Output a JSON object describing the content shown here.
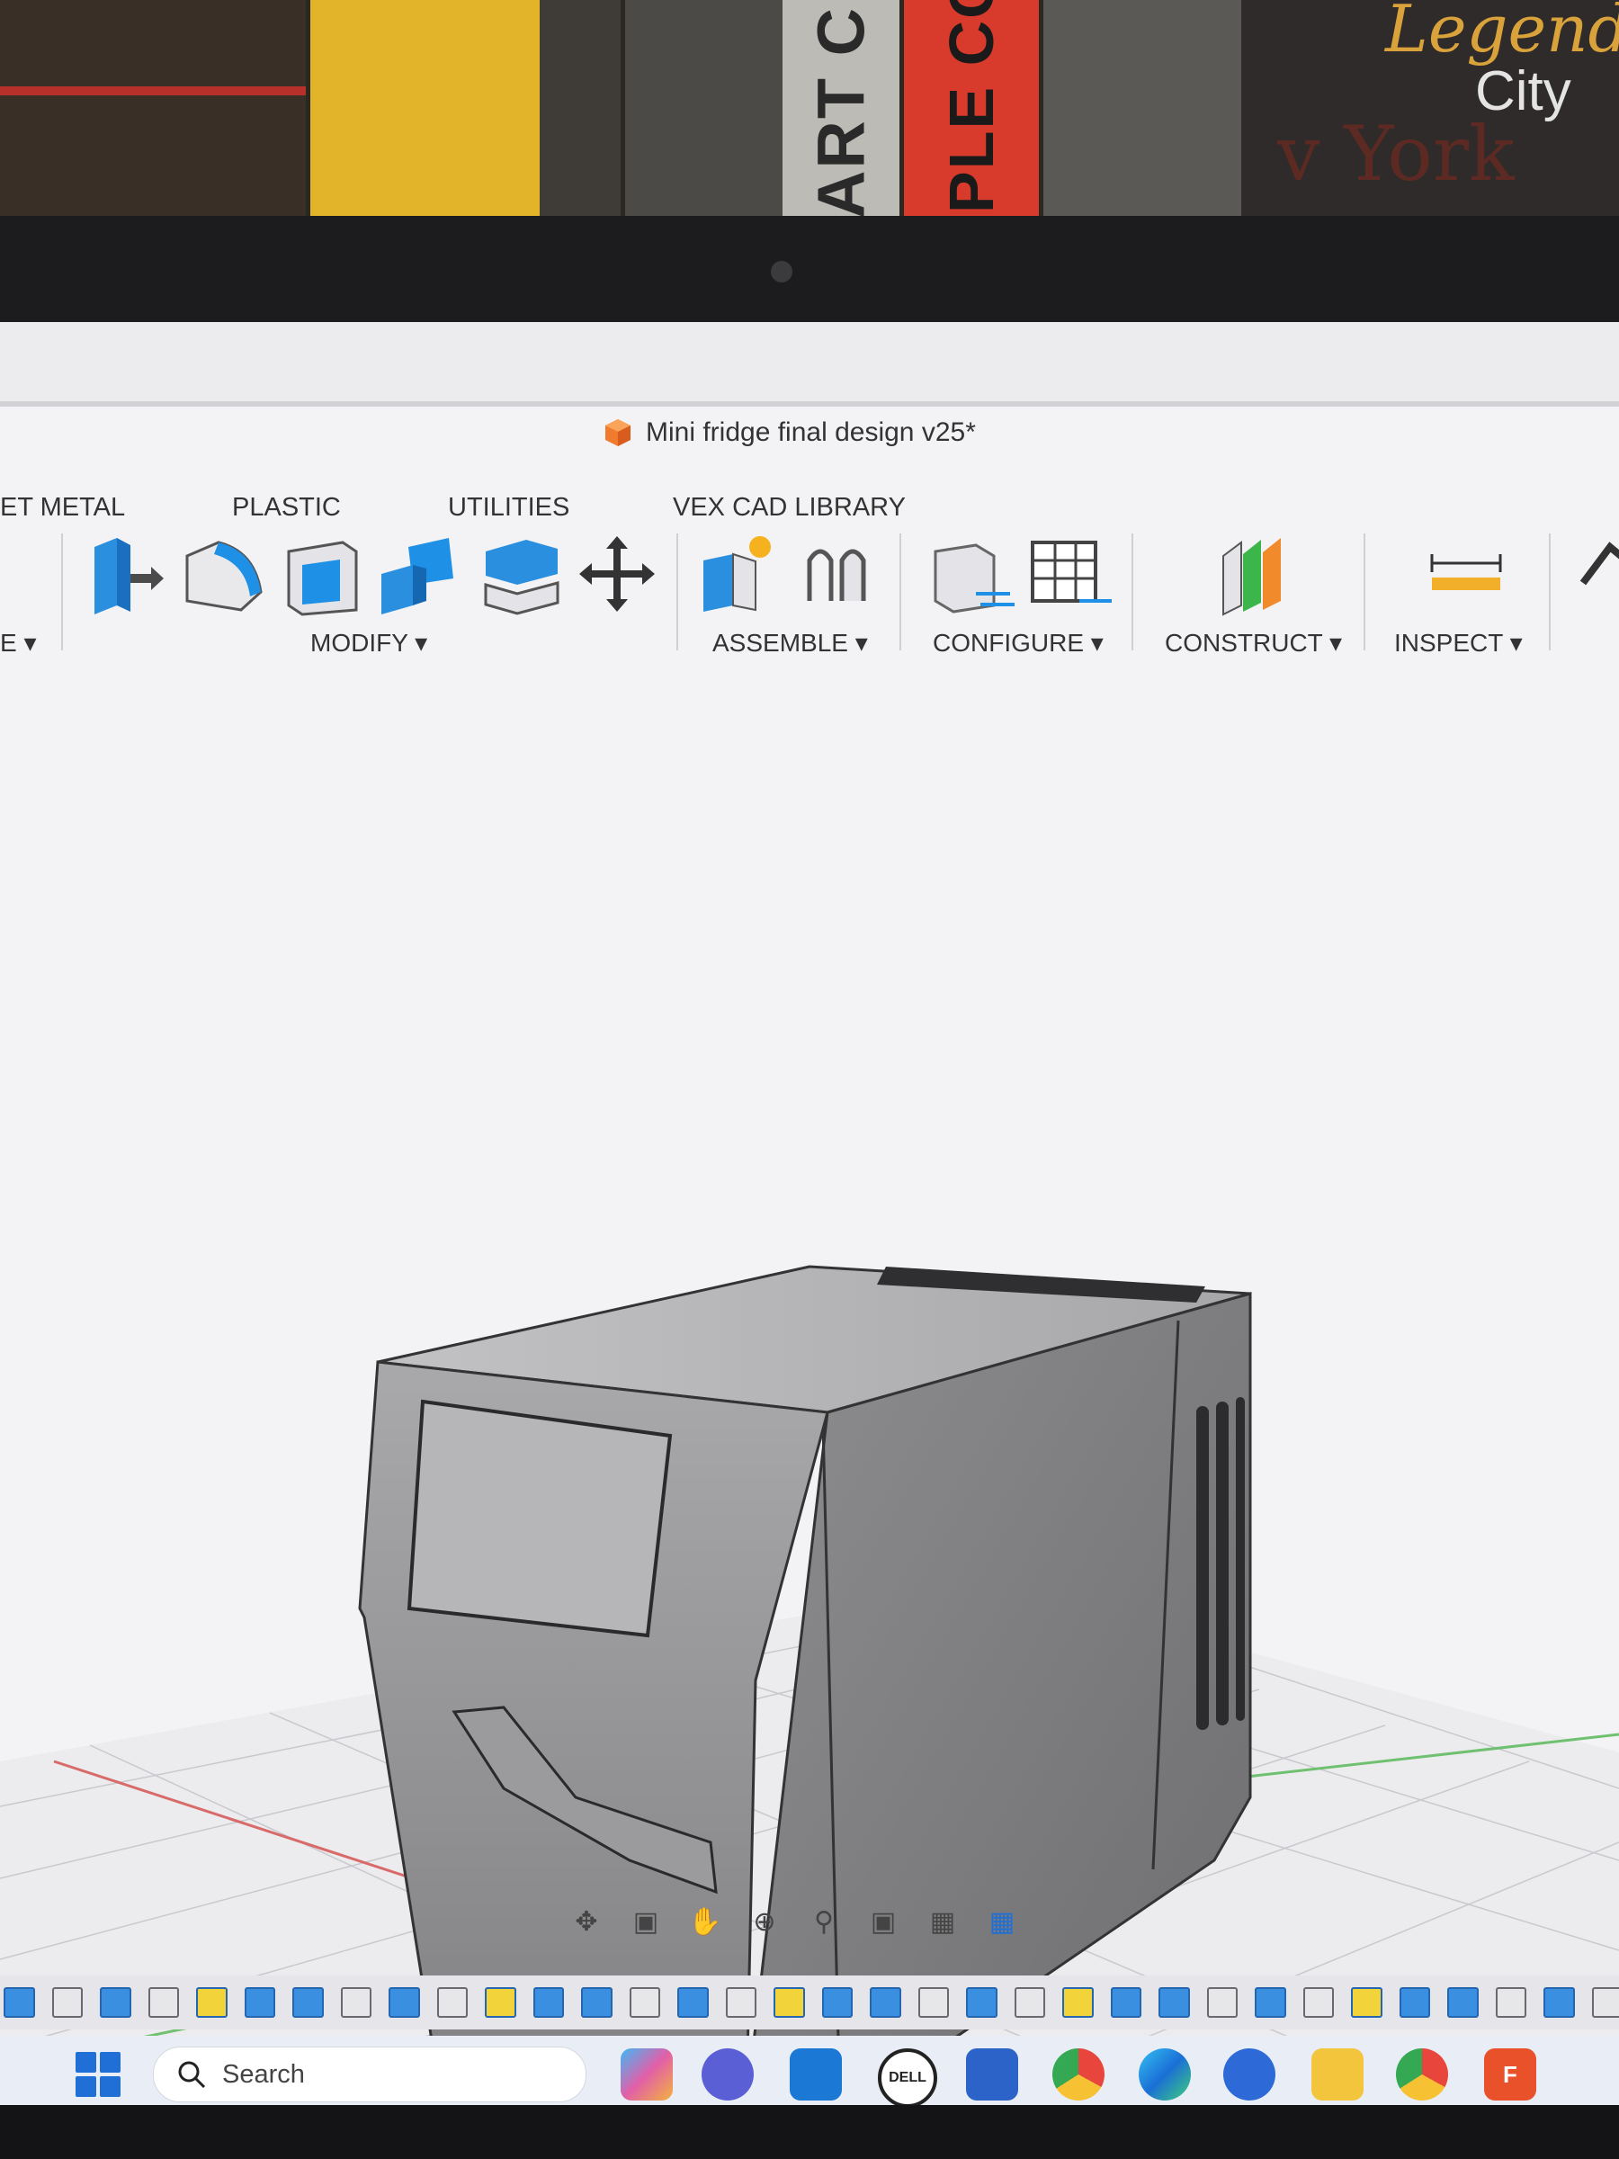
{
  "window": {
    "title": "Mini fridge final design v25*"
  },
  "tabs": [
    "ET METAL",
    "PLASTIC",
    "UTILITIES",
    "VEX CAD LIBRARY"
  ],
  "toolbar": {
    "left_dropdown_label": "E ▾",
    "groups": {
      "modify": "MODIFY ▾",
      "assemble": "ASSEMBLE ▾",
      "configure": "CONFIGURE ▾",
      "construct": "CONSTRUCT ▾",
      "inspect": "INSPECT ▾"
    },
    "icons": [
      "extrude-icon",
      "fillet-icon",
      "shell-icon",
      "combine-icon",
      "offset-face-icon",
      "move-icon",
      "new-component-icon",
      "joint-icon",
      "configure-icon",
      "table-icon",
      "construct-plane-icon",
      "measure-icon",
      "insert-icon"
    ]
  },
  "navigation_bar": {
    "icons": [
      "orbit-icon",
      "look-at-icon",
      "pan-icon",
      "zoom-icon",
      "fit-icon",
      "display-settings-icon",
      "grid-settings-icon",
      "viewports-icon"
    ]
  },
  "taskbar": {
    "search_placeholder": "Search",
    "apps": [
      "copilot-icon",
      "chat-icon",
      "mail-icon",
      "dell-icon",
      "store-icon",
      "chrome-icon",
      "edge-icon",
      "teams-icon",
      "file-explorer-icon",
      "chrome-profile-icon",
      "fusion-360-icon"
    ],
    "dell_label": "DELL",
    "fusion_label": "F"
  },
  "background": {
    "book_spine_1": "ART C",
    "book_spine_2": "PPLE CO",
    "poster_line_1": "Legend",
    "poster_line_2": "City",
    "poster_line_3": "v York"
  },
  "colors": {
    "accent_blue": "#1e90e6",
    "fusion_orange": "#e8512a",
    "model_gray": "#8d8d8f"
  }
}
